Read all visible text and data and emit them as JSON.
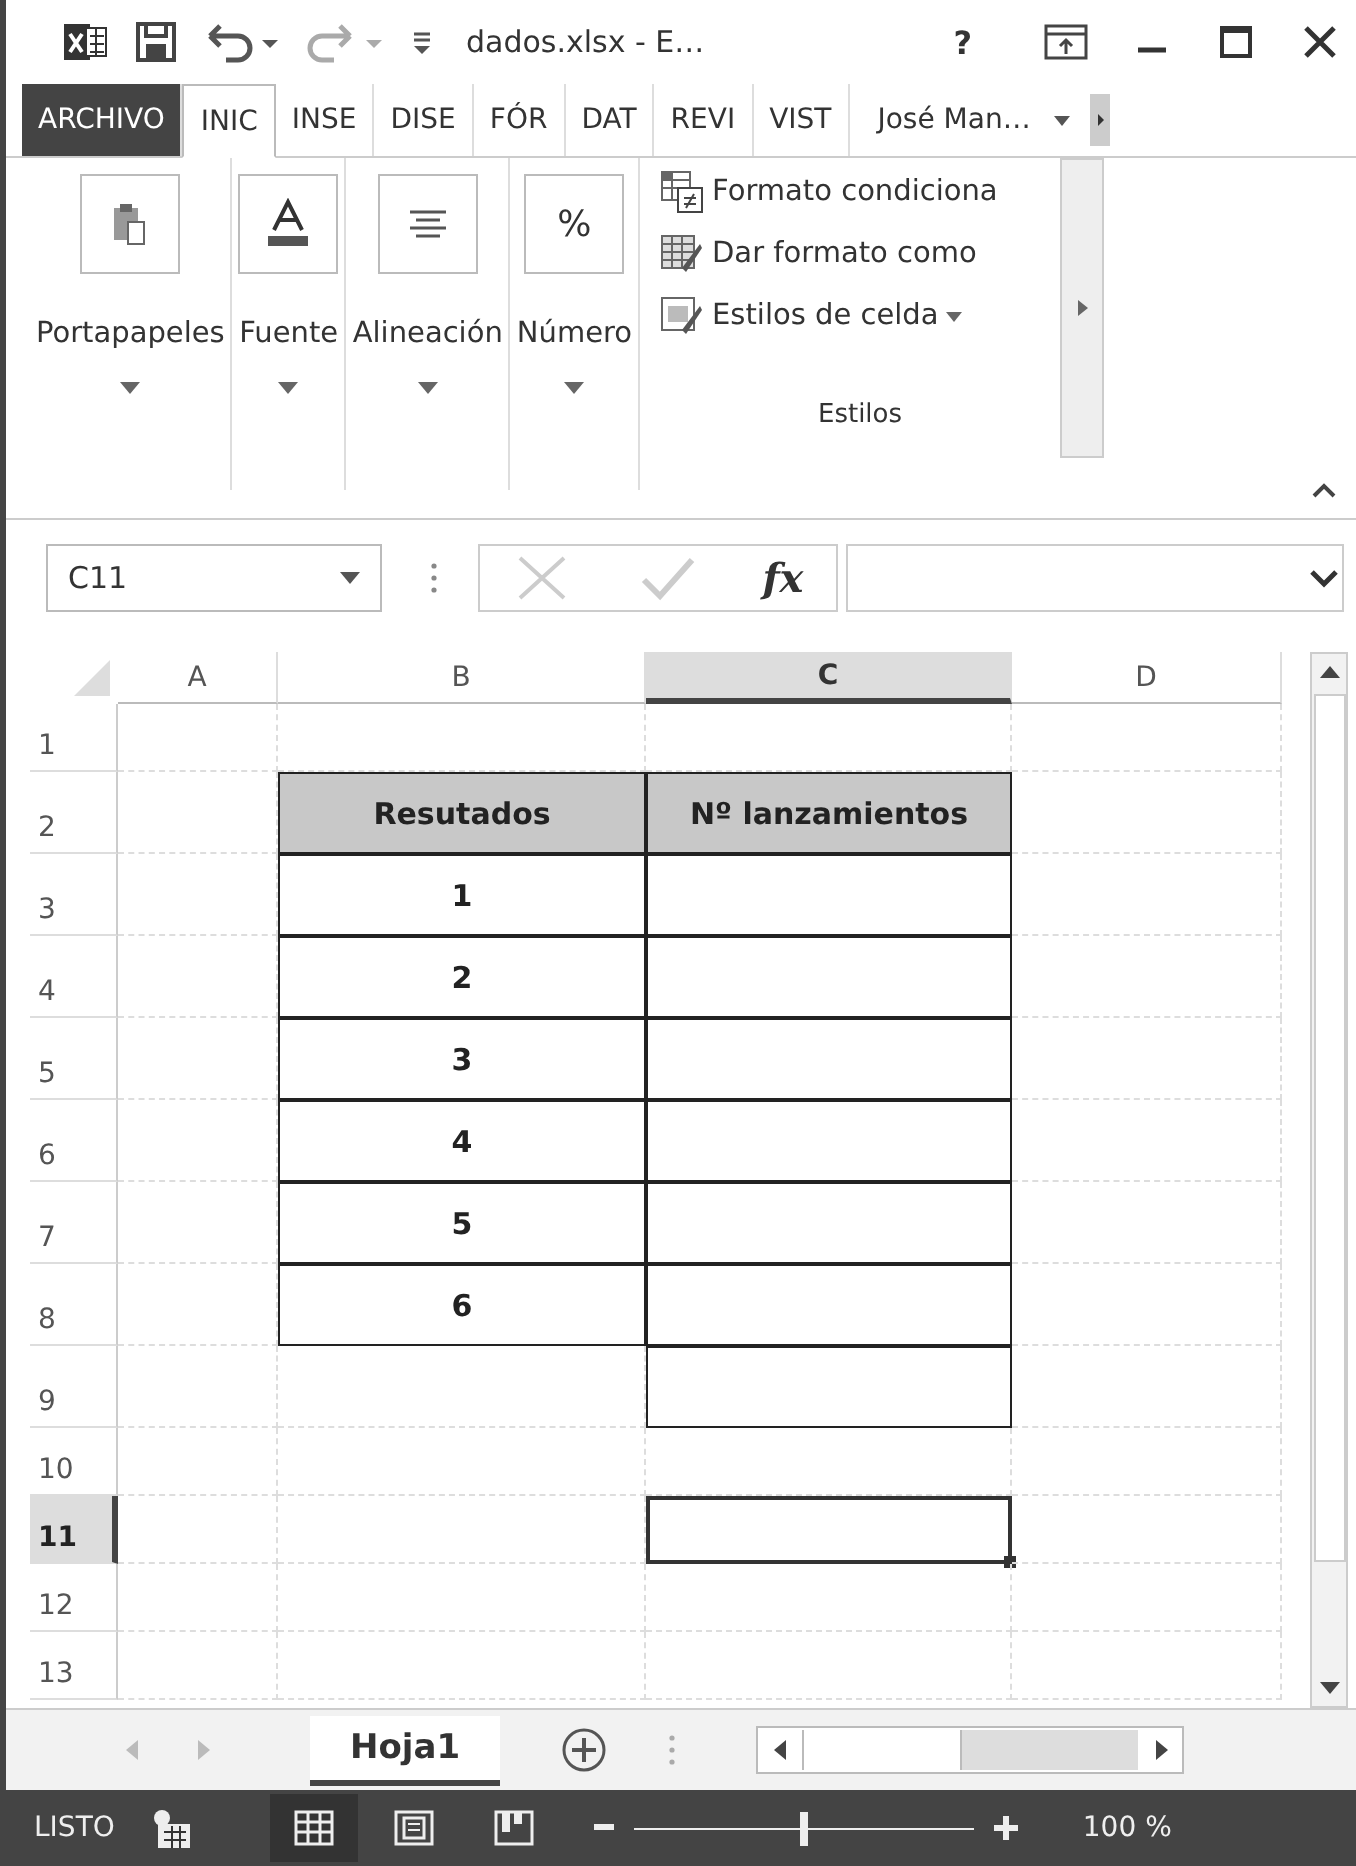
{
  "title_bar": {
    "title": "dados.xlsx - E…",
    "help": "?"
  },
  "ribbon_tabs": [
    {
      "label": "ARCHIVO",
      "kind": "file",
      "selected": false
    },
    {
      "label": "INIC",
      "kind": "tab",
      "selected": true
    },
    {
      "label": "INSE",
      "kind": "tab",
      "selected": false
    },
    {
      "label": "DISE",
      "kind": "tab",
      "selected": false
    },
    {
      "label": "FÓR",
      "kind": "tab",
      "selected": false
    },
    {
      "label": "DAT",
      "kind": "tab",
      "selected": false
    },
    {
      "label": "REVI",
      "kind": "tab",
      "selected": false
    },
    {
      "label": "VIST",
      "kind": "tab",
      "selected": false
    }
  ],
  "user": "José Man…",
  "ribbon_groups": [
    {
      "label": "Portapapeles",
      "kind": "clipboard"
    },
    {
      "label": "Fuente",
      "kind": "font"
    },
    {
      "label": "Alineación",
      "kind": "align"
    },
    {
      "label": "Número",
      "kind": "number",
      "symbol": "%"
    }
  ],
  "styles_group": {
    "label": "Estilos",
    "items": [
      {
        "label": "Formato condiciona",
        "kind": "conditional",
        "dropdown": false
      },
      {
        "label": "Dar formato como",
        "kind": "table",
        "dropdown": false
      },
      {
        "label": "Estilos de celda",
        "kind": "cell",
        "dropdown": true
      }
    ]
  },
  "formula_bar": {
    "name_box": "C11",
    "fx": "fx"
  },
  "columns": [
    {
      "label": "A",
      "selected": false
    },
    {
      "label": "B",
      "selected": false
    },
    {
      "label": "C",
      "selected": true
    },
    {
      "label": "D",
      "selected": false
    }
  ],
  "rows": [
    {
      "number": "1",
      "selected": false,
      "cells": [
        {
          "kind": "plain",
          "selected": false
        },
        {
          "kind": "plain",
          "selected": false
        },
        {
          "kind": "plain",
          "selected": false
        },
        {
          "kind": "plain",
          "selected": false
        }
      ]
    },
    {
      "number": "2",
      "selected": false,
      "cells": [
        {
          "kind": "plain",
          "selected": false
        },
        {
          "text": "Resutados",
          "kind": "header",
          "selected": false
        },
        {
          "text": "Nº lanzamientos",
          "kind": "header",
          "selected": false
        },
        {
          "kind": "plain",
          "selected": false
        }
      ]
    },
    {
      "number": "3",
      "selected": false,
      "cells": [
        {
          "kind": "plain",
          "selected": false
        },
        {
          "text": "1",
          "kind": "boxed",
          "selected": false
        },
        {
          "kind": "boxed",
          "selected": false
        },
        {
          "kind": "plain",
          "selected": false
        }
      ]
    },
    {
      "number": "4",
      "selected": false,
      "cells": [
        {
          "kind": "plain",
          "selected": false
        },
        {
          "text": "2",
          "kind": "boxed",
          "selected": false
        },
        {
          "kind": "boxed",
          "selected": false
        },
        {
          "kind": "plain",
          "selected": false
        }
      ]
    },
    {
      "number": "5",
      "selected": false,
      "cells": [
        {
          "kind": "plain",
          "selected": false
        },
        {
          "text": "3",
          "kind": "boxed",
          "selected": false
        },
        {
          "kind": "boxed",
          "selected": false
        },
        {
          "kind": "plain",
          "selected": false
        }
      ]
    },
    {
      "number": "6",
      "selected": false,
      "cells": [
        {
          "kind": "plain",
          "selected": false
        },
        {
          "text": "4",
          "kind": "boxed",
          "selected": false
        },
        {
          "kind": "boxed",
          "selected": false
        },
        {
          "kind": "plain",
          "selected": false
        }
      ]
    },
    {
      "number": "7",
      "selected": false,
      "cells": [
        {
          "kind": "plain",
          "selected": false
        },
        {
          "text": "5",
          "kind": "boxed",
          "selected": false
        },
        {
          "kind": "boxed",
          "selected": false
        },
        {
          "kind": "plain",
          "selected": false
        }
      ]
    },
    {
      "number": "8",
      "selected": false,
      "cells": [
        {
          "kind": "plain",
          "selected": false
        },
        {
          "text": "6",
          "kind": "boxed",
          "selected": false
        },
        {
          "kind": "boxed",
          "selected": false
        },
        {
          "kind": "plain",
          "selected": false
        }
      ]
    },
    {
      "number": "9",
      "selected": false,
      "cells": [
        {
          "kind": "plain",
          "selected": false
        },
        {
          "kind": "plain",
          "selected": false
        },
        {
          "kind": "boxed",
          "selected": false
        },
        {
          "kind": "plain",
          "selected": false
        }
      ]
    },
    {
      "number": "10",
      "selected": false,
      "cells": [
        {
          "kind": "plain",
          "selected": false
        },
        {
          "kind": "plain",
          "selected": false
        },
        {
          "kind": "plain",
          "selected": false
        },
        {
          "kind": "plain",
          "selected": false
        }
      ]
    },
    {
      "number": "11",
      "selected": true,
      "cells": [
        {
          "kind": "plain",
          "selected": false
        },
        {
          "kind": "plain",
          "selected": false
        },
        {
          "kind": "plain",
          "selected": true
        },
        {
          "kind": "plain",
          "selected": false
        }
      ]
    },
    {
      "number": "12",
      "selected": false,
      "cells": [
        {
          "kind": "plain",
          "selected": false
        },
        {
          "kind": "plain",
          "selected": false
        },
        {
          "kind": "plain",
          "selected": false
        },
        {
          "kind": "plain",
          "selected": false
        }
      ]
    },
    {
      "number": "13",
      "selected": false,
      "cells": [
        {
          "kind": "plain",
          "selected": false
        },
        {
          "kind": "plain",
          "selected": false
        },
        {
          "kind": "plain",
          "selected": false
        },
        {
          "kind": "plain",
          "selected": false
        }
      ]
    }
  ],
  "sheet_tabs": [
    {
      "label": "Hoja1",
      "selected": true
    }
  ],
  "status_bar": {
    "status": "LISTO",
    "views": [
      {
        "kind": "normal",
        "selected": true
      },
      {
        "kind": "page_layout",
        "selected": false
      },
      {
        "kind": "page_break",
        "selected": false
      }
    ],
    "zoom": {
      "level": 0.5,
      "reading": "100 %"
    }
  }
}
